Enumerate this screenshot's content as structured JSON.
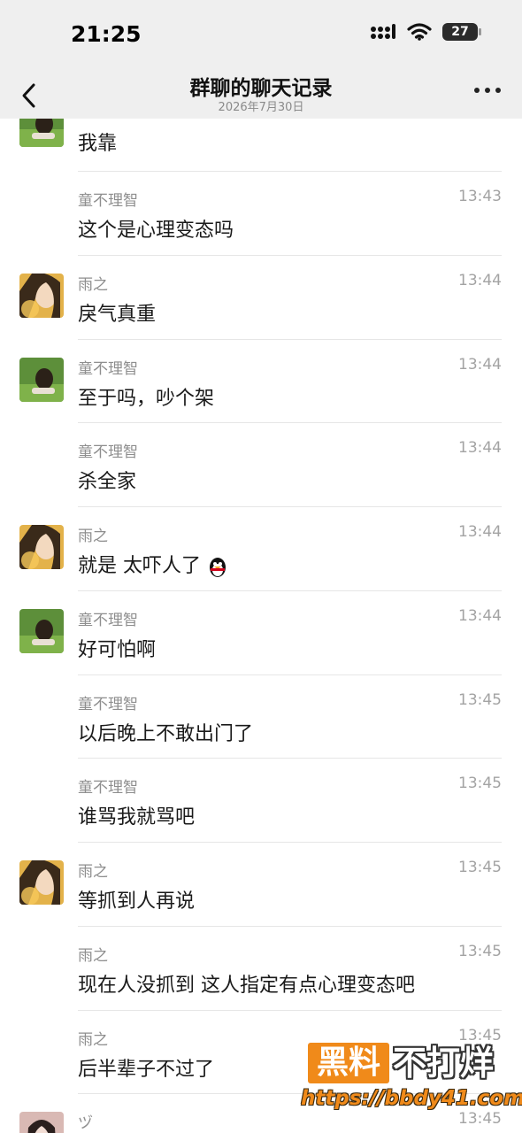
{
  "status_bar": {
    "time": "21:25",
    "battery": "27"
  },
  "nav": {
    "title": "群聊的聊天记录",
    "subtitle": "2026年7月30日"
  },
  "messages": [
    {
      "sender": "",
      "time": "",
      "text": "我靠",
      "avatar": "green-avatar"
    },
    {
      "sender": "童不理智",
      "time": "13:43",
      "text": "这个是心理变态吗",
      "avatar": ""
    },
    {
      "sender": "雨之",
      "time": "13:44",
      "text": "戾气真重",
      "avatar": "warm-avatar"
    },
    {
      "sender": "童不理智",
      "time": "13:44",
      "text": "至于吗，吵个架",
      "avatar": "green-avatar"
    },
    {
      "sender": "童不理智",
      "time": "13:44",
      "text": "杀全家",
      "avatar": ""
    },
    {
      "sender": "雨之",
      "time": "13:44",
      "text": "就是 太吓人了",
      "avatar": "warm-avatar",
      "emoji": "penguin-emoji"
    },
    {
      "sender": "童不理智",
      "time": "13:44",
      "text": "好可怕啊",
      "avatar": "green-avatar"
    },
    {
      "sender": "童不理智",
      "time": "13:45",
      "text": "以后晚上不敢出门了",
      "avatar": ""
    },
    {
      "sender": "童不理智",
      "time": "13:45",
      "text": "谁骂我就骂吧",
      "avatar": ""
    },
    {
      "sender": "雨之",
      "time": "13:45",
      "text": "等抓到人再说",
      "avatar": "warm-avatar"
    },
    {
      "sender": "雨之",
      "time": "13:45",
      "text": "现在人没抓到 这人指定有点心理变态吧",
      "avatar": ""
    },
    {
      "sender": "雨之",
      "time": "13:45",
      "text": "后半辈子不过了",
      "avatar": ""
    },
    {
      "sender": "ヅ",
      "time": "13:45",
      "text": "",
      "avatar": "pink-avatar"
    }
  ],
  "watermark": {
    "brand": "黑料",
    "slogan": "不打烊",
    "url": "https://bbdy41.com"
  },
  "colors": {
    "header_bg": "#efefef",
    "divider": "#e6e6e6",
    "meta_text": "#8e8e8e",
    "watermark_orange": "#f08a1a"
  }
}
